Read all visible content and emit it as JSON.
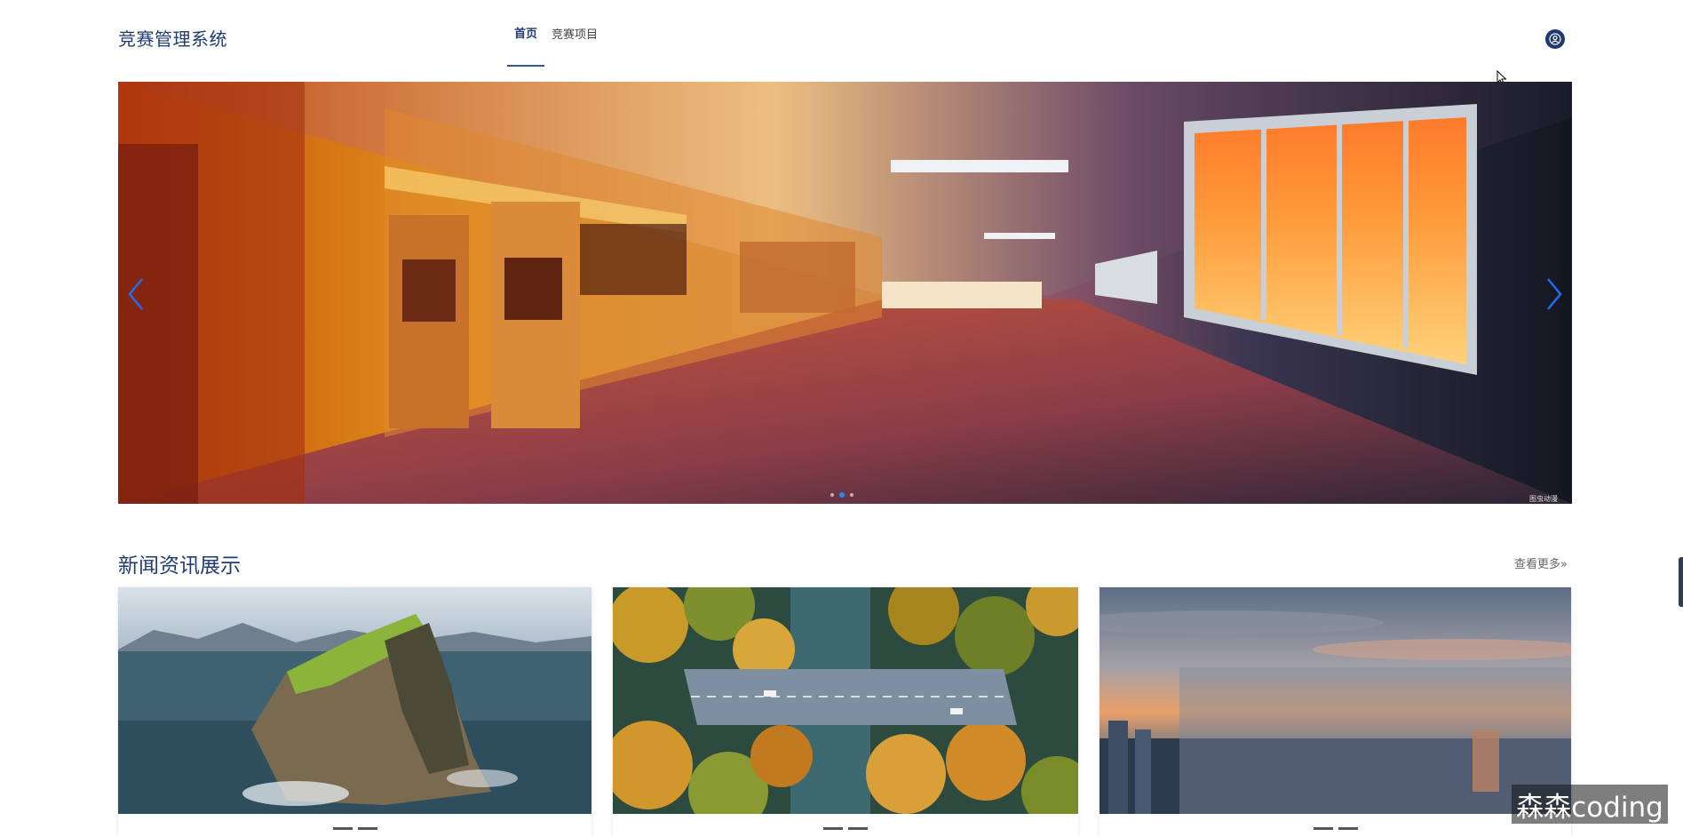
{
  "header": {
    "app_title": "竞赛管理系统",
    "nav": [
      {
        "label": "首页",
        "active": true
      },
      {
        "label": "竞赛项目",
        "active": false
      }
    ],
    "avatar_icon": "user-icon"
  },
  "banner": {
    "slide_count": 3,
    "active_slide": 2,
    "prev_icon": "chevron-left-icon",
    "next_icon": "chevron-right-icon",
    "image_watermark": "图虫动漫"
  },
  "news": {
    "section_title": "新闻资讯展示",
    "more_label": "查看更多»"
  },
  "watermark": "森森coding",
  "colors": {
    "brand": "#1f3d73",
    "accent": "#1d8cf8"
  }
}
